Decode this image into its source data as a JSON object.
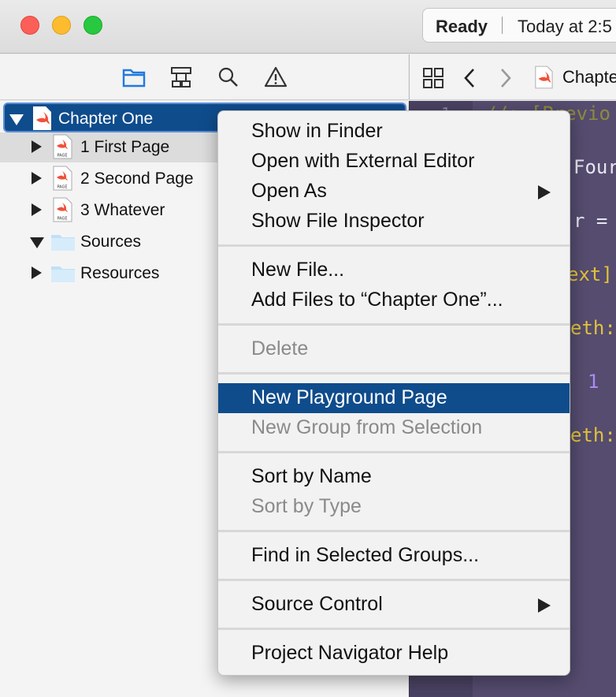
{
  "titlebar": {
    "status_ready": "Ready",
    "status_time": "Today at 2:5"
  },
  "navigator": {
    "icons": [
      "folder-icon",
      "hierarchy-icon",
      "search-icon",
      "warning-icon"
    ]
  },
  "tree": [
    {
      "label": "Chapter One",
      "expanded": true,
      "kind": "playground",
      "selected": true
    },
    {
      "label": "1 First Page",
      "expanded": false,
      "kind": "page"
    },
    {
      "label": "2 Second Page",
      "expanded": false,
      "kind": "page"
    },
    {
      "label": "3 Whatever",
      "expanded": false,
      "kind": "page"
    },
    {
      "label": "Sources",
      "expanded": true,
      "kind": "folder"
    },
    {
      "label": "Resources",
      "expanded": false,
      "kind": "folder"
    }
  ],
  "editor": {
    "breadcrumb": "Chapte",
    "gutter_line": "1",
    "code": {
      "line1": "//: [Previo",
      "line2": "Four",
      "line3": "r =",
      "line4": "ext]",
      "line5": "eth:",
      "line6": "1",
      "line7": "eth:"
    }
  },
  "context_menu": {
    "items": {
      "show_in_finder": "Show in Finder",
      "open_external": "Open with External Editor",
      "open_as": "Open As",
      "show_file_inspector": "Show File Inspector",
      "new_file": "New File...",
      "add_files": "Add Files to “Chapter One”...",
      "delete": "Delete",
      "new_playground_page": "New Playground Page",
      "new_group_from_selection": "New Group from Selection",
      "sort_by_name": "Sort by Name",
      "sort_by_type": "Sort by Type",
      "find_in_selected_groups": "Find in Selected Groups...",
      "source_control": "Source Control",
      "project_navigator_help": "Project Navigator Help"
    }
  },
  "colors": {
    "selection": "#0f4c8c",
    "editor_background": "#554c6f",
    "keyword_yellow": "#e2c23a"
  }
}
